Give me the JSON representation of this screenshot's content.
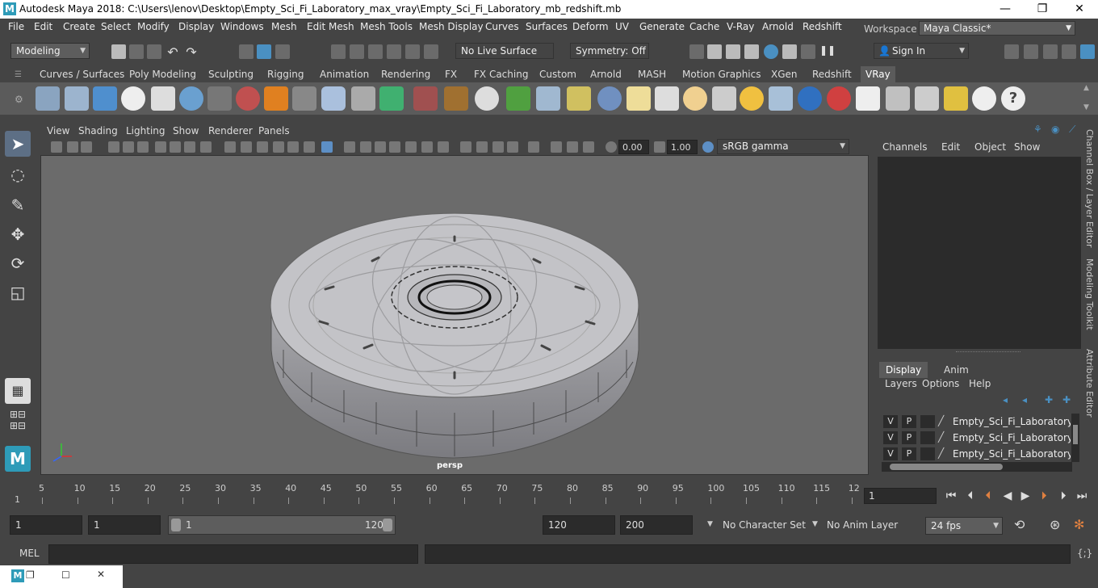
{
  "window": {
    "title": "Autodesk Maya 2018: C:\\Users\\lenov\\Desktop\\Empty_Sci_Fi_Laboratory_max_vray\\Empty_Sci_Fi_Laboratory_mb_redshift.mb",
    "app_icon": "M",
    "minimize": "—",
    "maximize": "❐",
    "close": "✕"
  },
  "menubar": {
    "items": [
      "File",
      "Edit",
      "Create",
      "Select",
      "Modify",
      "Display",
      "Windows",
      "Mesh",
      "Edit Mesh",
      "Mesh Tools",
      "Mesh Display",
      "Curves",
      "Surfaces",
      "Deform",
      "UV",
      "Generate",
      "Cache",
      "V-Ray",
      "Arnold",
      "Redshift"
    ],
    "workspace_label": "Workspace :",
    "workspace_value": "Maya Classic*"
  },
  "statusline": {
    "menu_set": "Modeling",
    "live_surface": "No Live Surface",
    "symmetry": "Symmetry: Off",
    "sign_in": "Sign In"
  },
  "shelf": {
    "tabs": [
      "Curves / Surfaces",
      "Poly Modeling",
      "Sculpting",
      "Rigging",
      "Animation",
      "Rendering",
      "FX",
      "FX Caching",
      "Custom",
      "Arnold",
      "MASH",
      "Motion Graphics",
      "XGen",
      "Redshift",
      "VRay"
    ],
    "active_tab": "VRay"
  },
  "viewport": {
    "menu": [
      "View",
      "Shading",
      "Lighting",
      "Show",
      "Renderer",
      "Panels"
    ],
    "exposure": "0.00",
    "gamma": "1.00",
    "color_space": "sRGB gamma",
    "camera_label": "persp"
  },
  "channel_box": {
    "menu": [
      "Channels",
      "Edit",
      "Object",
      "Show"
    ],
    "layer_tabs": [
      "Display",
      "Anim"
    ],
    "layer_menu": [
      "Layers",
      "Options",
      "Help"
    ],
    "layers": [
      {
        "v": "V",
        "p": "P",
        "name": "Empty_Sci_Fi_Laboratory_lay"
      },
      {
        "v": "V",
        "p": "P",
        "name": "Empty_Sci_Fi_Laboratory_lay"
      },
      {
        "v": "V",
        "p": "P",
        "name": "Empty_Sci_Fi_Laboratory_lay"
      }
    ],
    "side_tabs": [
      "Channel Box / Layer Editor",
      "Modeling Toolkit",
      "Attribute Editor"
    ]
  },
  "timeline": {
    "ticks": [
      "5",
      "10",
      "15",
      "20",
      "25",
      "30",
      "35",
      "40",
      "45",
      "50",
      "55",
      "60",
      "65",
      "70",
      "75",
      "80",
      "85",
      "90",
      "95",
      "100",
      "105",
      "110",
      "115",
      "12"
    ],
    "start_marker": "1",
    "current_frame": "1"
  },
  "range": {
    "start": "1",
    "playback_start": "1",
    "slider_start": "1",
    "slider_end": "120",
    "playback_end": "120",
    "end": "200",
    "character_set": "No Character Set",
    "anim_layer": "No Anim Layer",
    "fps": "24 fps"
  },
  "command": {
    "label": "MEL"
  }
}
